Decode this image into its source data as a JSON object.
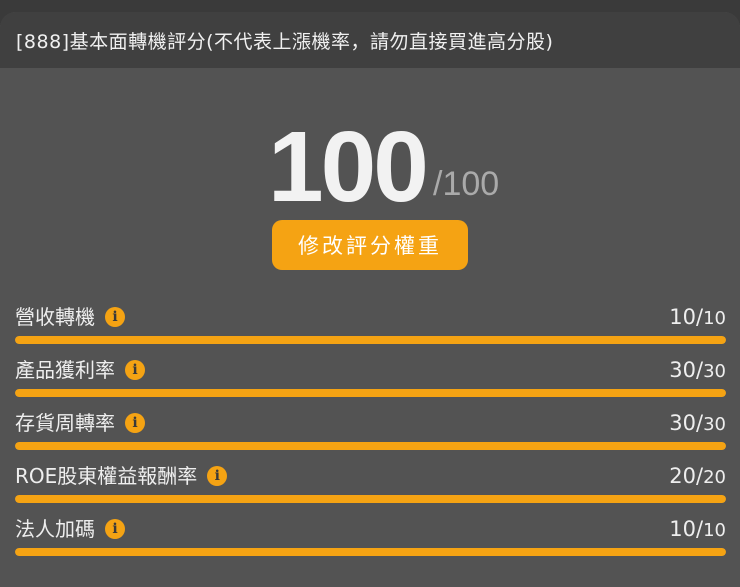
{
  "header": {
    "title": "[888]基本面轉機評分(不代表上漲機率，請勿直接買進高分股)"
  },
  "score": {
    "value": "100",
    "max": "/100"
  },
  "edit_button": {
    "label": "修改評分權重"
  },
  "accent_color": "#f5a313",
  "factors": [
    {
      "label": "營收轉機",
      "score": "10",
      "max": "10",
      "fill": 1.0,
      "icon": "info-icon"
    },
    {
      "label": "產品獲利率",
      "score": "30",
      "max": "30",
      "fill": 1.0,
      "icon": "info-icon"
    },
    {
      "label": "存貨周轉率",
      "score": "30",
      "max": "30",
      "fill": 1.0,
      "icon": "info-icon"
    },
    {
      "label": "ROE股東權益報酬率",
      "score": "20",
      "max": "20",
      "fill": 1.0,
      "icon": "info-icon"
    },
    {
      "label": "法人加碼",
      "score": "10",
      "max": "10",
      "fill": 1.0,
      "icon": "info-icon"
    }
  ]
}
